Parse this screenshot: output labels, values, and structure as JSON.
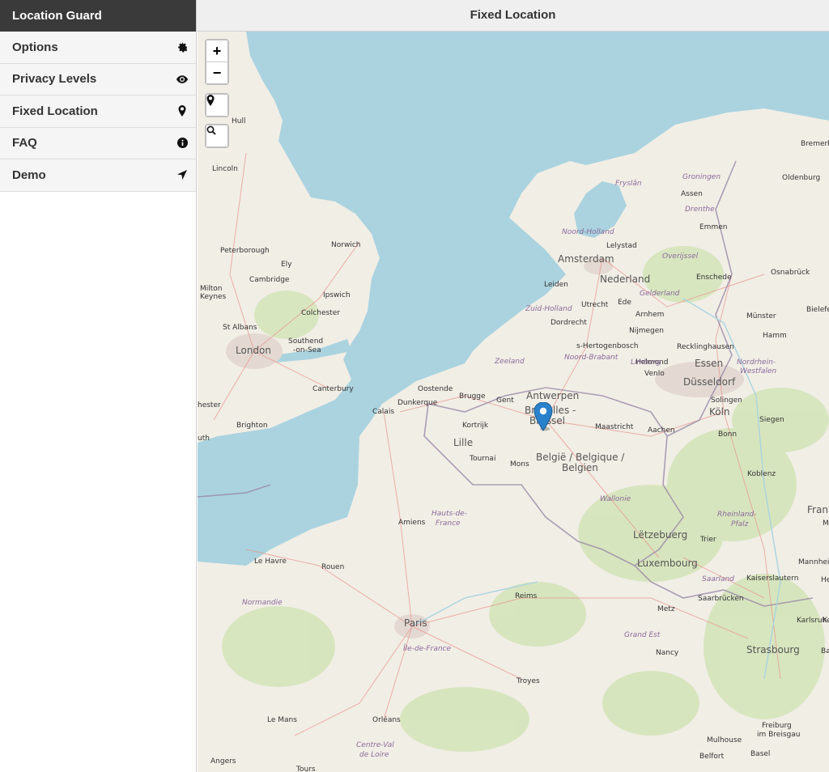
{
  "sidebar": {
    "title": "Location Guard",
    "items": [
      {
        "label": "Options",
        "icon": "gear-icon"
      },
      {
        "label": "Privacy Levels",
        "icon": "eye-icon"
      },
      {
        "label": "Fixed Location",
        "icon": "map-pin-icon"
      },
      {
        "label": "FAQ",
        "icon": "info-icon"
      },
      {
        "label": "Demo",
        "icon": "location-arrow-icon"
      }
    ]
  },
  "header": {
    "title": "Fixed Location"
  },
  "map": {
    "zoom_in": "+",
    "zoom_out": "−",
    "cities": {
      "hull": "Hull",
      "lincoln": "Lincoln",
      "norwich": "Norwich",
      "peterborough": "Peterborough",
      "ely": "Ely",
      "cambridge": "Cambridge",
      "milton": "Milton",
      "keynes": "Keynes",
      "ipswich": "Ipswich",
      "colchester": "Colchester",
      "st_albans": "St Albans",
      "southend": "Southend",
      "on_sea": "-on-Sea",
      "london": "London",
      "canterbury": "Canterbury",
      "brighton": "Brighton",
      "chester": "hester",
      "uth": "uth",
      "calais": "Calais",
      "dunkerque": "Dunkerque",
      "oostende": "Oostende",
      "brugge": "Brugge",
      "gent": "Gent",
      "antwerpen": "Antwerpen",
      "bruxelles": "Bruxelles -",
      "brussel": "Brussel",
      "kortrijk": "Kortrijk",
      "lille": "Lille",
      "tournai": "Tournai",
      "mons": "Mons",
      "maastricht": "Maastricht",
      "aachen": "Aachen",
      "amsterdam": "Amsterdam",
      "leiden": "Leiden",
      "utrecht": "Utrecht",
      "ede": "Ede",
      "arnhem": "Arnhem",
      "dordrecht": "Dordrecht",
      "nijmegen": "Nijmegen",
      "s_hertogenbosch": "s-Hertogenbosch",
      "helmond": "Helmond",
      "venlo": "Venlo",
      "lelystad": "Lelystad",
      "assen": "Assen",
      "emmen": "Emmen",
      "enschede": "Enschede",
      "oldenburg": "Oldenburg",
      "bremerh": "Bremerh",
      "osnabruck": "Osnabrück",
      "munster": "Münster",
      "bielefe": "Bielefe",
      "hamm": "Hamm",
      "recklinghausen": "Recklinghausen",
      "essen": "Essen",
      "dusseldorf": "Düsseldorf",
      "solingen": "Solingen",
      "koln": "Köln",
      "siegen": "Siegen",
      "bonn": "Bonn",
      "koblenz": "Koblenz",
      "frankf": "Frankf",
      "trier": "Trier",
      "luxembourg": "Luxembourg",
      "mannhei": "Mannhei",
      "kaiserslautern": "Kaiserslautern",
      "saarbrucken": "Saarbrücken",
      "karlsruhe": "Karlsruhe",
      "metz": "Metz",
      "nancy": "Nancy",
      "strasbourg": "Strasbourg",
      "reims": "Reims",
      "paris": "Paris",
      "amiens": "Amiens",
      "rouen": "Rouen",
      "le_havre": "Le Havre",
      "troyes": "Troyes",
      "le_mans": "Le Mans",
      "orleans": "Orléans",
      "tours": "Tours",
      "angers": "Angers",
      "mulhouse": "Mulhouse",
      "freiburg": "Freiburg",
      "im_breisgau": "im Breisgau",
      "basel": "Basel",
      "belfort": "Belfort",
      "ba": "Ba",
      "he": "He",
      "m": "M",
      "k": "K"
    },
    "countries": {
      "nederland": "Nederland",
      "belgie": "België / Belgique /",
      "belgien": "Belgien",
      "letzebuerg": "Lëtzebuerg"
    },
    "regions": {
      "groningen": "Groningen",
      "fryslan": "Fryslân",
      "drenthe": "Drenthe",
      "noord_holland": "Noord-Holland",
      "overijssel": "Overijssel",
      "gelderland": "Gelderland",
      "zuid_holland": "Zuid-Holland",
      "zeeland": "Zeeland",
      "noord_brabant": "Noord-Brabant",
      "limburg": "Limburg",
      "nordrhein": "Nordrhein-",
      "westfalen": "Westfalen",
      "wallonie": "Wallonie",
      "rheinland": "Rheinland-",
      "pfalz": "Pfalz",
      "saarland": "Saarland",
      "hauts": "Hauts-de-",
      "france": "France",
      "normandie": "Normandie",
      "ile_de_france": "Île-de-France",
      "grand_est": "Grand Est",
      "centre_val": "Centre-Val",
      "de_loire": "de Loire"
    }
  },
  "colors": {
    "sea": "#aad3df",
    "land": "#f1eee6",
    "green": "#d9e8c3",
    "border": "#9a8aa8",
    "marker": "#2a81cb",
    "sidebar_header": "#3a3a3a"
  }
}
